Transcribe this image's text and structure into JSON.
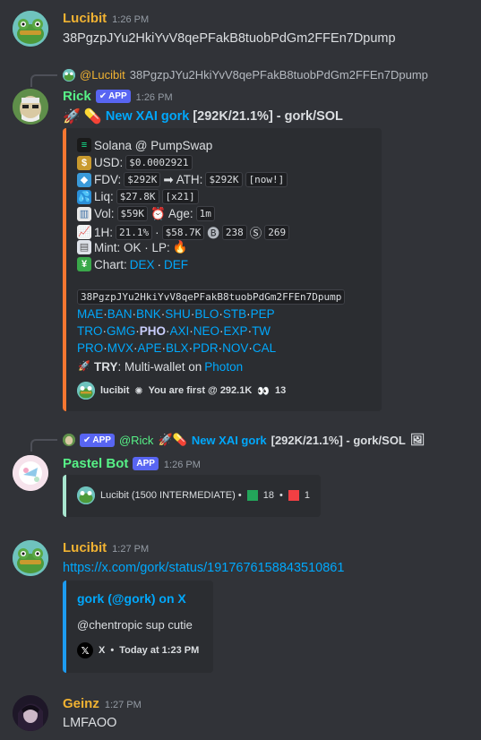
{
  "messages": {
    "m1": {
      "username": "Lucibit",
      "timestamp": "1:26 PM",
      "text": "38PgzpJYu2HkiYvV8qePFakB8tuobPdGm2FFEn7Dpump"
    },
    "m2": {
      "reply": {
        "mention": "@Lucibit",
        "text": "38PgzpJYu2HkiYvV8qePFakB8tuobPdGm2FFEn7Dpump"
      },
      "username": "Rick",
      "badge": "APP",
      "timestamp": "1:26 PM",
      "title_link": "New XAI gork",
      "title_rest": "[292K/21.1%] - gork/SOL",
      "embed": {
        "dex": "Solana @ PumpSwap",
        "usd_label": "USD:",
        "usd": "$0.0002921",
        "fdv_label": "FDV:",
        "fdv": "$292K",
        "ath_label": "ATH:",
        "ath": "$292K",
        "ath_when": "[now!]",
        "liq_label": "Liq:",
        "liq": "$27.8K",
        "liq_mult": "[x21]",
        "vol_label": "Vol:",
        "vol": "$59K",
        "age_label": "Age:",
        "age": "1m",
        "h1_label": "1H:",
        "h1_pct": "21.1%",
        "h1_sep": "·",
        "h1_val": "$58.7K",
        "buys": "238",
        "sells": "269",
        "mint": "Mint: OK · LP:",
        "chart_label": "Chart:",
        "chart_dex": "DEX",
        "chart_sep": "·",
        "chart_def": "DEF",
        "address": "38PgzpJYu2HkiYvV8qePFakB8tuobPdGm2FFEn7Dpump",
        "links_row1": [
          "MAE",
          "BAN",
          "BNK",
          "SHU",
          "BLO",
          "STB",
          "PEP"
        ],
        "links_row2": [
          "TRO",
          "GMG",
          "PHO",
          "AXI",
          "NEO",
          "EXP",
          "TW"
        ],
        "links_row3": [
          "PRO",
          "MVX",
          "APE",
          "BLX",
          "PDR",
          "NOV",
          "CAL"
        ],
        "try_bold": "TRY",
        "try_text": ": Multi-wallet on",
        "try_link": "Photon",
        "footer_user": "lucibit",
        "footer_text": "You are first @ 292.1K",
        "footer_count": "13"
      }
    },
    "m3": {
      "reply": {
        "badge": "APP",
        "mention": "@Rick",
        "link": "New XAI gork",
        "rest": "[292K/21.1%] - gork/SOL"
      },
      "username": "Pastel Bot",
      "badge": "APP",
      "timestamp": "1:26 PM",
      "embed": {
        "text": "Lucibit (1500 INTERMEDIATE) •",
        "green": "18",
        "dot": "•",
        "red": "1"
      }
    },
    "m4": {
      "username": "Lucibit",
      "timestamp": "1:27 PM",
      "link": "https://x.com/gork/status/1917676158843510861",
      "embed": {
        "title": "gork (@gork) on X",
        "desc": "@chentropic sup cutie",
        "source": "X",
        "time": "Today at 1:23 PM"
      }
    },
    "m5": {
      "username": "Geinz",
      "timestamp": "1:27 PM",
      "text": "LMFAOO"
    }
  },
  "colors": {
    "background": "#313338",
    "embed_bg": "#2b2d31",
    "lucibit": "#f0b232",
    "rick": "#57f287",
    "pastel": "#57f287",
    "geinz": "#f0b232",
    "link": "#00a8fc",
    "badge": "#5865f2",
    "embed_orange": "#f57731",
    "embed_mint": "#a8e6cf",
    "embed_blue": "#1d9bf0"
  }
}
